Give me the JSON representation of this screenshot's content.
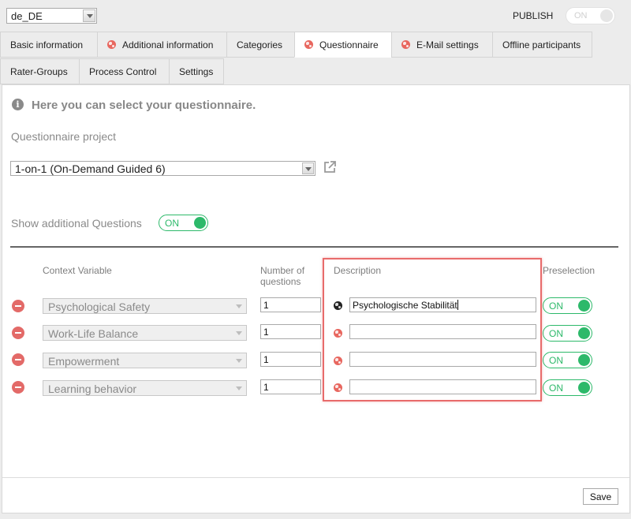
{
  "language": {
    "selected": "de_DE"
  },
  "publish": {
    "label": "PUBLISH",
    "toggle_label": "ON"
  },
  "tabs_row1": [
    {
      "label": "Basic information",
      "globe": false
    },
    {
      "label": "Additional information",
      "globe": true
    },
    {
      "label": "Categories",
      "globe": false
    },
    {
      "label": "Questionnaire",
      "globe": true,
      "active": true
    },
    {
      "label": "E-Mail settings",
      "globe": true
    },
    {
      "label": "Offline participants",
      "globe": false
    }
  ],
  "tabs_row2": [
    {
      "label": "Rater-Groups"
    },
    {
      "label": "Process Control"
    },
    {
      "label": "Settings"
    }
  ],
  "main": {
    "headline": "Here you can select your questionnaire.",
    "project_label": "Questionnaire project",
    "project_selected": "1-on-1 (On-Demand Guided 6)",
    "additional_label": "Show additional Questions",
    "additional_toggle": "ON"
  },
  "table": {
    "headers": {
      "context": "Context Variable",
      "number_line1": "Number of",
      "number_line2": "questions",
      "description": "Description",
      "preselection": "Preselection"
    },
    "rows": [
      {
        "context": "Psychological Safety",
        "number": "1",
        "description": "Psychologische Stabilität",
        "preselection": "ON"
      },
      {
        "context": "Work-Life Balance",
        "number": "1",
        "description": "",
        "preselection": "ON"
      },
      {
        "context": "Empowerment",
        "number": "1",
        "description": "",
        "preselection": "ON"
      },
      {
        "context": "Learning behavior",
        "number": "1",
        "description": "",
        "preselection": "ON"
      }
    ]
  },
  "footer": {
    "save_label": "Save"
  },
  "colors": {
    "accent_green": "#2db96a",
    "remove_red": "#e36a68",
    "highlight": "#e86b6b"
  }
}
